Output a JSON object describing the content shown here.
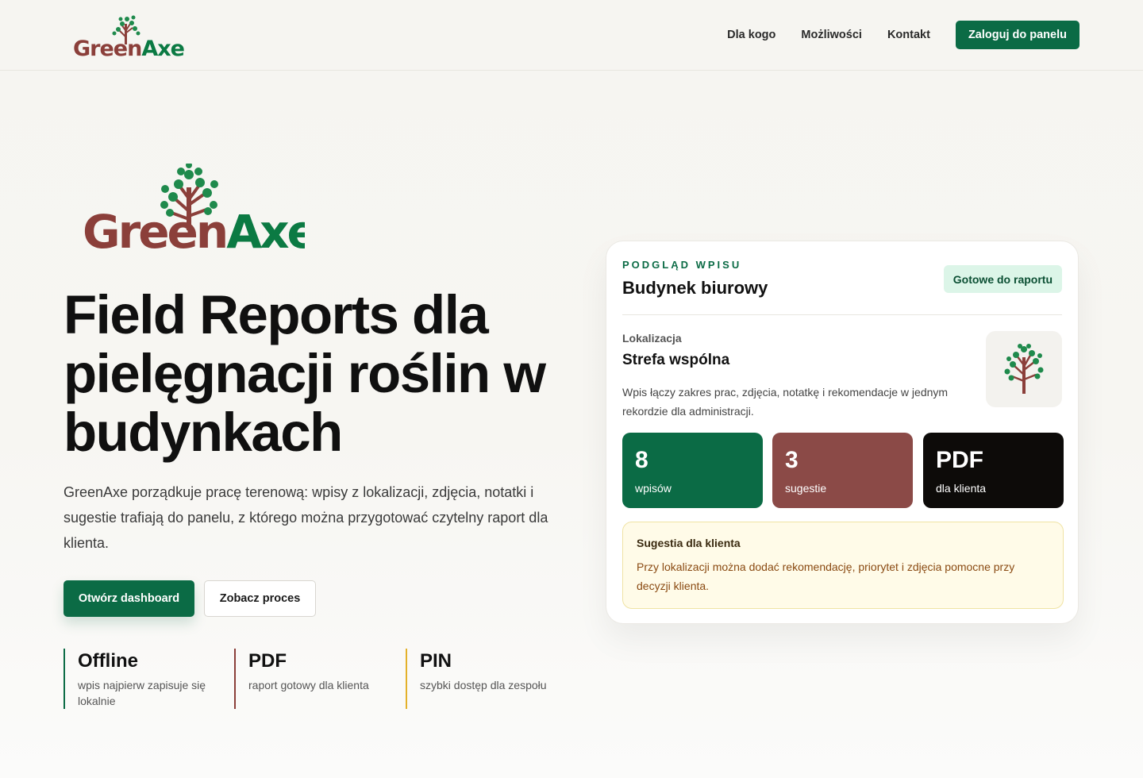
{
  "brand": {
    "name_part1": "Green",
    "name_part2": "Axe"
  },
  "colors": {
    "accent": "#0b6b45",
    "brand_red": "#8b3f3a",
    "suggest_text": "#8a4a12"
  },
  "nav": {
    "links": [
      "Dla kogo",
      "Możliwości",
      "Kontakt"
    ],
    "login_button": "Zaloguj do panelu"
  },
  "hero": {
    "title": "Field Reports dla pielęgnacji roślin w budynkach",
    "text": "GreenAxe porządkuje pracę terenową: wpisy z lokalizacji, zdjęcia, notatki i sugestie trafiają do panelu, z którego można przygotować czytelny raport dla klienta.",
    "primary_button": "Otwórz dashboard",
    "secondary_button": "Zobacz proces"
  },
  "features": [
    {
      "title": "Offline",
      "desc": "wpis najpierw zapisuje się lokalnie",
      "color": "#0b6b45"
    },
    {
      "title": "PDF",
      "desc": "raport gotowy dla klienta",
      "color": "#8b3f3a"
    },
    {
      "title": "PIN",
      "desc": "szybki dostęp dla zespołu",
      "color": "#e3b12a"
    }
  ],
  "card": {
    "eyebrow": "PODGLĄD WPISU",
    "title": "Budynek biurowy",
    "status": "Gotowe do raportu",
    "location_label": "Lokalizacja",
    "location_name": "Strefa wspólna",
    "location_desc": "Wpis łączy zakres prac, zdjęcia, notatkę i rekomendacje w jednym rekordzie dla administracji.",
    "stats": [
      {
        "value": "8",
        "label": "wpisów",
        "color": "#0b6b45"
      },
      {
        "value": "3",
        "label": "sugestie",
        "color": "#8b4a47"
      },
      {
        "value": "PDF",
        "label": "dla klienta",
        "color": "#0d0b09"
      }
    ],
    "suggestion": {
      "title": "Sugestia dla klienta",
      "text": "Przy lokalizacji można dodać rekomendację, priorytet i zdjęcia pomocne przy decyzji klienta."
    }
  }
}
